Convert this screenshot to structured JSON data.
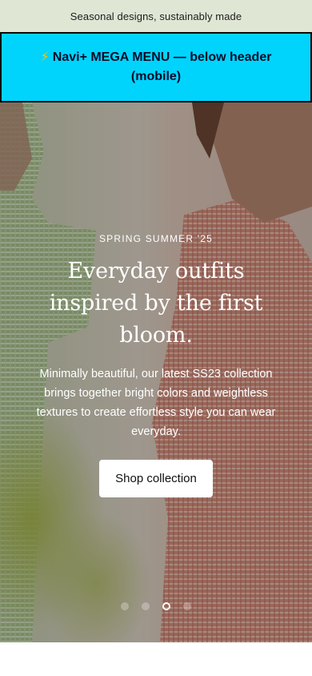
{
  "announcement": {
    "text": "Seasonal designs, sustainably made"
  },
  "mega_menu": {
    "icon": "lightning-bolt-icon",
    "icon_glyph": "⚡",
    "text": "Navi+ MEGA MENU — below header (mobile)",
    "background": "#00d4fd"
  },
  "hero": {
    "eyebrow": "SPRING SUMMER '25",
    "headline": "Everyday outfits inspired by the first bloom.",
    "description": "Minimally beautiful, our latest SS23 collection brings together bright colors and weightless textures to create effortless style you can wear everyday.",
    "cta_label": "Shop collection",
    "slides": [
      {
        "active": false
      },
      {
        "active": false
      },
      {
        "active": true
      },
      {
        "active": false
      }
    ]
  },
  "colors": {
    "announcement_bg": "#dfe6d4",
    "cta_bg": "#ffffff"
  }
}
